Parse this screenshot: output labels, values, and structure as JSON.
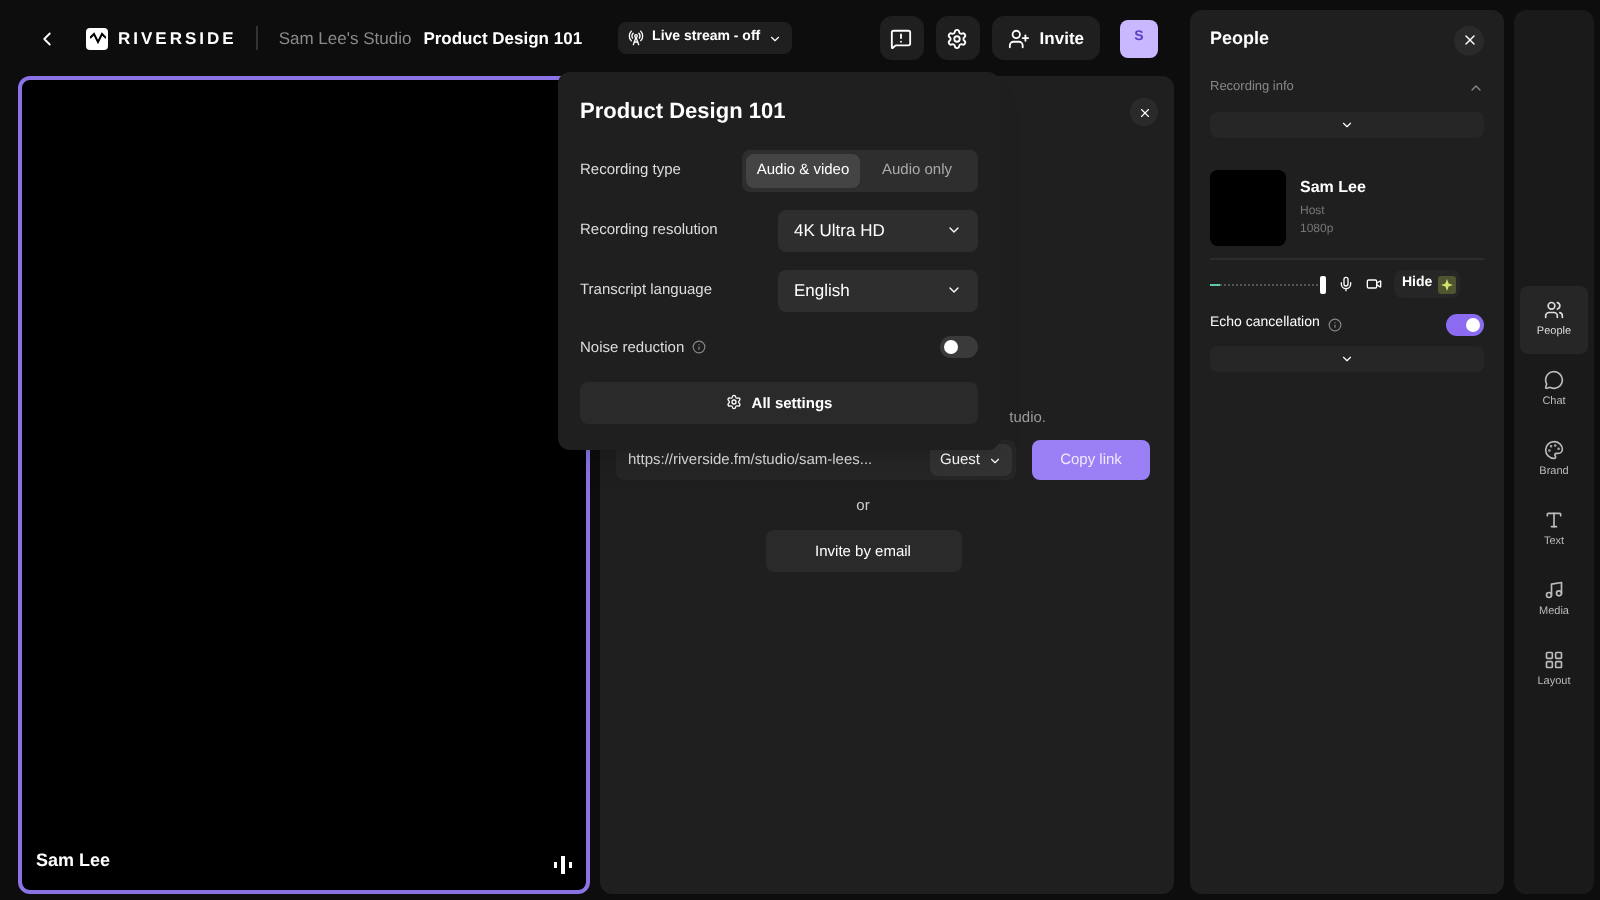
{
  "topbar": {
    "logo": "RIVERSIDE",
    "studio": "Sam Lee's Studio",
    "project": "Product Design 101",
    "live_stream": "Live stream - off",
    "invite": "Invite",
    "avatar": "S"
  },
  "video": {
    "name": "Sam Lee"
  },
  "popover": {
    "title": "Product Design 101",
    "recording_type": {
      "label": "Recording type",
      "options": [
        {
          "label": "Audio & video",
          "selected": true
        },
        {
          "label": "Audio only",
          "selected": false
        }
      ]
    },
    "resolution": {
      "label": "Recording resolution",
      "value": "4K Ultra HD"
    },
    "language": {
      "label": "Transcript language",
      "value": "English"
    },
    "noise": {
      "label": "Noise reduction",
      "on": false
    },
    "all_settings": "All settings"
  },
  "invite_panel": {
    "partial_text": "tudio.",
    "link": "https://riverside.fm/studio/sam-lees...",
    "role": "Guest",
    "copy": "Copy link",
    "or": "or",
    "email": "Invite by email"
  },
  "people": {
    "title": "People",
    "recording_info": "Recording info",
    "person": {
      "name": "Sam Lee",
      "role": "Host",
      "quality": "1080p"
    },
    "volume": {
      "level": 1
    },
    "hide": "Hide",
    "echo": {
      "label": "Echo cancellation",
      "on": true
    }
  },
  "rail": [
    {
      "label": "People",
      "selected": true
    },
    {
      "label": "Chat",
      "selected": false
    },
    {
      "label": "Brand",
      "selected": false
    },
    {
      "label": "Text",
      "selected": false
    },
    {
      "label": "Media",
      "selected": false
    },
    {
      "label": "Layout",
      "selected": false
    }
  ]
}
